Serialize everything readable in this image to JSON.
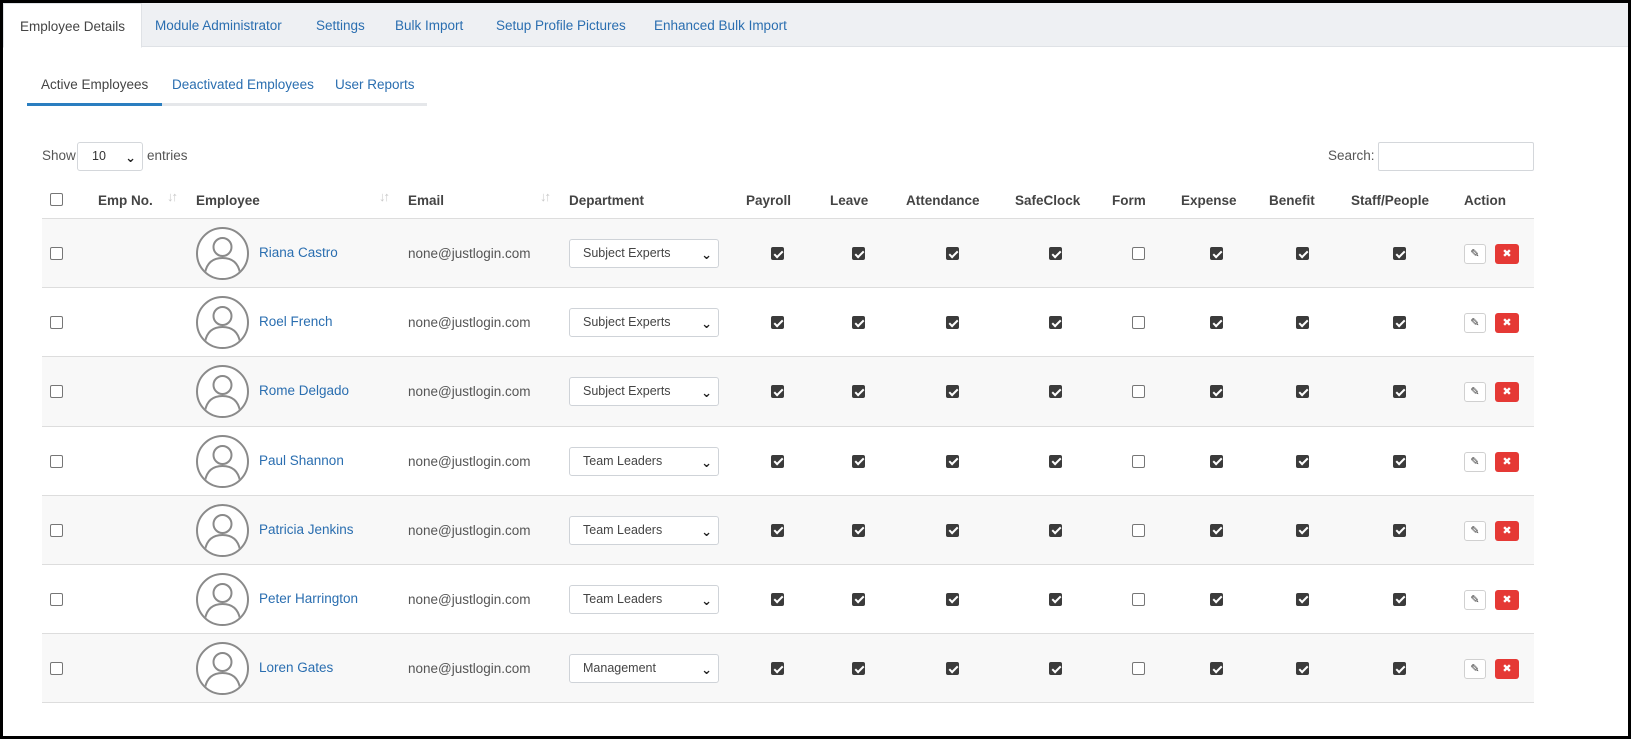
{
  "top_tabs": [
    {
      "label": "Employee Details",
      "active": true
    },
    {
      "label": "Module Administrator",
      "active": false
    },
    {
      "label": "Settings",
      "active": false
    },
    {
      "label": "Bulk Import",
      "active": false
    },
    {
      "label": "Setup Profile Pictures",
      "active": false
    },
    {
      "label": "Enhanced Bulk Import",
      "active": false
    }
  ],
  "sub_tabs": [
    {
      "label": "Active Employees",
      "active": true
    },
    {
      "label": "Deactivated Employees",
      "active": false
    },
    {
      "label": "User Reports",
      "active": false
    }
  ],
  "length": {
    "show_label": "Show",
    "value": "10",
    "entries_label": "entries"
  },
  "search": {
    "label": "Search:",
    "value": "",
    "placeholder": ""
  },
  "columns": [
    "Emp No.",
    "Employee",
    "Email",
    "Department",
    "Payroll",
    "Leave",
    "Attendance",
    "SafeClock",
    "Form",
    "Expense",
    "Benefit",
    "Staff/People",
    "Action"
  ],
  "sortable_columns": [
    "Emp No.",
    "Employee",
    "Email"
  ],
  "select_all_checked": false,
  "rows": [
    {
      "emp_no": "",
      "name": "Riana Castro",
      "email": "none@justlogin.com",
      "department": "Subject Experts",
      "selected": false,
      "modules": [
        true,
        true,
        true,
        true,
        false,
        true,
        true,
        true
      ]
    },
    {
      "emp_no": "",
      "name": "Roel French",
      "email": "none@justlogin.com",
      "department": "Subject Experts",
      "selected": false,
      "modules": [
        true,
        true,
        true,
        true,
        false,
        true,
        true,
        true
      ]
    },
    {
      "emp_no": "",
      "name": "Rome Delgado",
      "email": "none@justlogin.com",
      "department": "Subject Experts",
      "selected": false,
      "modules": [
        true,
        true,
        true,
        true,
        false,
        true,
        true,
        true
      ]
    },
    {
      "emp_no": "",
      "name": "Paul Shannon",
      "email": "none@justlogin.com",
      "department": "Team Leaders",
      "selected": false,
      "modules": [
        true,
        true,
        true,
        true,
        false,
        true,
        true,
        true
      ]
    },
    {
      "emp_no": "",
      "name": "Patricia Jenkins",
      "email": "none@justlogin.com",
      "department": "Team Leaders",
      "selected": false,
      "modules": [
        true,
        true,
        true,
        true,
        false,
        true,
        true,
        true
      ]
    },
    {
      "emp_no": "",
      "name": "Peter Harrington",
      "email": "none@justlogin.com",
      "department": "Team Leaders",
      "selected": false,
      "modules": [
        true,
        true,
        true,
        true,
        false,
        true,
        true,
        true
      ]
    },
    {
      "emp_no": "",
      "name": "Loren Gates",
      "email": "none@justlogin.com",
      "department": "Management",
      "selected": false,
      "modules": [
        true,
        true,
        true,
        true,
        false,
        true,
        true,
        true
      ]
    }
  ],
  "icons": {
    "edit": "pencil-icon",
    "delete": "x-icon",
    "avatar": "user-silhouette-icon",
    "sort": "sort-arrows-icon",
    "dropdown": "chevron-down-icon"
  },
  "colors": {
    "link": "#2a6eb0",
    "active_tab_underline": "#2a7ec0",
    "delete_button": "#e53935",
    "row_stripe": "#f8f8f8",
    "tab_bar_bg": "#eef0f3"
  }
}
